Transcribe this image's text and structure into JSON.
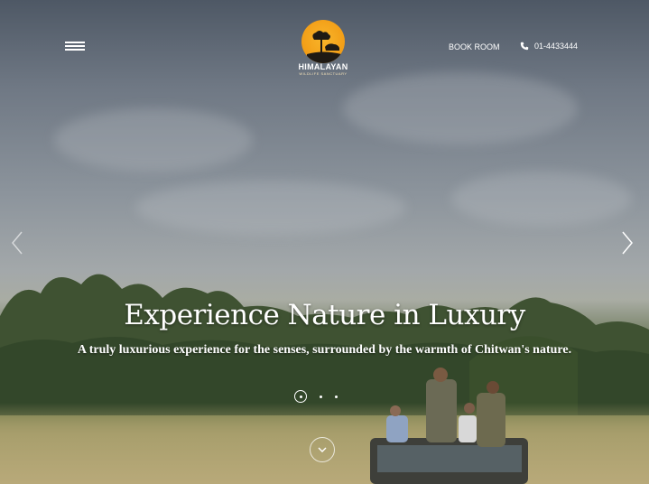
{
  "header": {
    "menu_icon": "hamburger-icon",
    "logo": {
      "name": "HIMALAYAN",
      "tagline": "WILDLIFE SANCTUARY",
      "accent_color": "#F29D16"
    },
    "book_label": "BOOK ROOM",
    "phone_icon": "phone-icon",
    "phone_number": "01-4433444"
  },
  "hero": {
    "headline": "Experience Nature in Luxury",
    "subheadline": "A truly luxurious experience for the senses, surrounded by the warmth of Chitwan's nature.",
    "prev_icon": "chevron-left-icon",
    "next_icon": "chevron-right-icon",
    "slides": {
      "count": 3,
      "active_index": 1
    },
    "scroll_icon": "chevron-down-icon"
  }
}
